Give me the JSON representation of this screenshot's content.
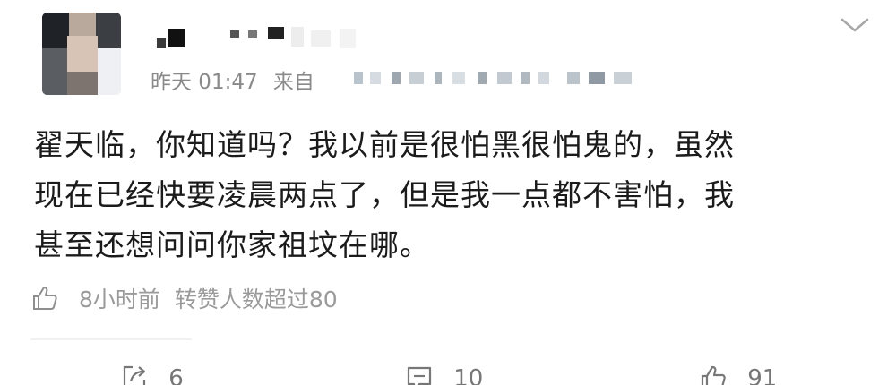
{
  "post": {
    "meta": {
      "time": "昨天 01:47",
      "source_prefix": "来自"
    },
    "content_lines": [
      "翟天临，你知道吗？我以前是很怕黑很怕鬼的，虽然",
      "现在已经快要凌晨两点了，但是我一点都不害怕，我",
      "甚至还想问问你家祖坟在哪。"
    ],
    "stats": {
      "time_ago": "8小时前",
      "summary": "转赞人数超过80"
    },
    "actions": {
      "repost_count": "6",
      "comment_count": "10",
      "like_count": "91"
    }
  },
  "icons": {
    "expand": "chevron-down-icon",
    "like_small": "thumbs-up-icon",
    "repost": "share-icon",
    "comment": "comment-icon",
    "like": "thumbs-up-icon"
  },
  "colors": {
    "text": "#1b1b1b",
    "secondary_text": "#8a8a8a",
    "icon": "#777777"
  }
}
